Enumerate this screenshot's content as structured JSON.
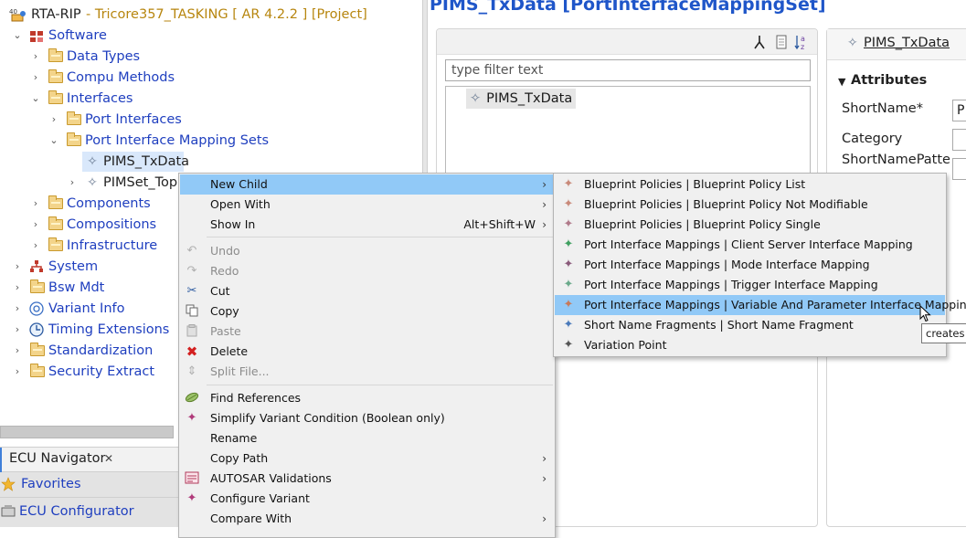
{
  "tree": {
    "root": {
      "name": "RTA-RIP",
      "detail": " - Tricore357_TASKING [ AR 4.2.2 ] [Project]"
    },
    "items": [
      {
        "label": "Software"
      },
      {
        "label": "Data Types"
      },
      {
        "label": "Compu Methods"
      },
      {
        "label": "Interfaces"
      },
      {
        "label": "Port Interfaces"
      },
      {
        "label": "Port Interface Mapping Sets"
      },
      {
        "label": "PIMS_TxData"
      },
      {
        "label": "PIMSet_TopL"
      },
      {
        "label": "Components"
      },
      {
        "label": "Compositions"
      },
      {
        "label": "Infrastructure"
      },
      {
        "label": "System"
      },
      {
        "label": "Bsw Mdt"
      },
      {
        "label": "Variant Info"
      },
      {
        "label": "Timing Extensions"
      },
      {
        "label": "Standardization"
      },
      {
        "label": "Security Extract"
      }
    ]
  },
  "editor": {
    "title": "PIMS_TxData [PortInterfaceMappingSet]",
    "filter_placeholder": "type filter text",
    "outline_selected": "PIMS_TxData"
  },
  "properties": {
    "tab_label": "PIMS_TxData",
    "section": "Attributes",
    "fields": [
      {
        "label": "ShortName*",
        "value": "P"
      },
      {
        "label": "Category",
        "value": ""
      },
      {
        "label": "ShortNamePatte",
        "value": ""
      }
    ]
  },
  "bottom_panels": {
    "navigator_tab": "ECU Navigator",
    "navigator_close": "✕",
    "favorites": "Favorites",
    "ecu_configurator": "ECU Configurator"
  },
  "context_menu": {
    "items": [
      {
        "label": "New Child",
        "submenu": true
      },
      {
        "label": "Open With",
        "submenu": true
      },
      {
        "label": "Show In",
        "accelerator": "Alt+Shift+W",
        "submenu": true
      },
      {
        "label": "Undo",
        "disabled": true
      },
      {
        "label": "Redo",
        "disabled": true
      },
      {
        "label": "Cut"
      },
      {
        "label": "Copy"
      },
      {
        "label": "Paste",
        "disabled": true
      },
      {
        "label": "Delete"
      },
      {
        "label": "Split File...",
        "disabled": true
      },
      {
        "label": "Find References"
      },
      {
        "label": "Simplify Variant Condition (Boolean only)"
      },
      {
        "label": "Rename"
      },
      {
        "label": "Copy Path",
        "submenu": true
      },
      {
        "label": "AUTOSAR Validations",
        "submenu": true
      },
      {
        "label": "Configure Variant"
      },
      {
        "label": "Compare With",
        "submenu": true
      }
    ],
    "submenu_arrow": "›"
  },
  "submenu": {
    "items": [
      {
        "label": "Blueprint Policies | Blueprint Policy List"
      },
      {
        "label": "Blueprint Policies | Blueprint Policy Not Modifiable"
      },
      {
        "label": "Blueprint Policies | Blueprint Policy Single"
      },
      {
        "label": "Port Interface Mappings | Client Server Interface Mapping"
      },
      {
        "label": "Port Interface Mappings | Mode Interface Mapping"
      },
      {
        "label": "Port Interface Mappings | Trigger Interface Mapping"
      },
      {
        "label": "Port Interface Mappings | Variable And Parameter Interface Mapping"
      },
      {
        "label": "Short Name Fragments | Short Name Fragment"
      },
      {
        "label": "Variation Point"
      }
    ]
  },
  "tooltip": {
    "text": "creates a"
  },
  "colors": {
    "link_blue": "#1f3fbf",
    "title_blue": "#1f56c9",
    "menu_highlight": "#91c9f7",
    "folder_yellow": "#f3d48a"
  }
}
